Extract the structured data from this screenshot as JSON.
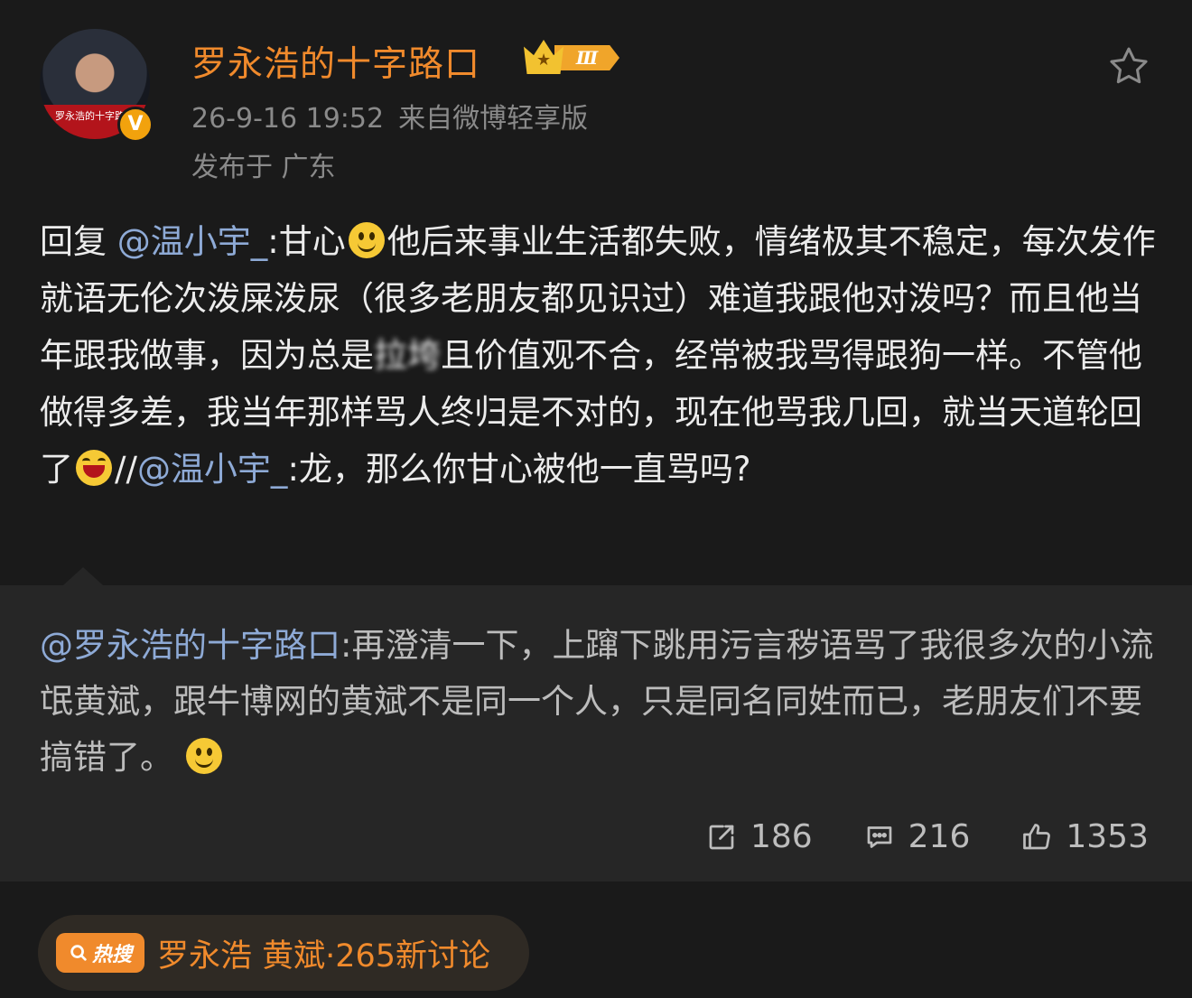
{
  "author": {
    "name": "罗永浩的十字路口",
    "avatar_caption": "罗永浩的十字路口",
    "verified_badge": "V",
    "level_badge": "Ⅲ",
    "timestamp": "26-9-16 19:52",
    "source": "来自微博轻享版",
    "location": "发布于 广东"
  },
  "post": {
    "reply_prefix": "回复",
    "mention_1": "@温小宇_",
    "part_1": ":甘心",
    "part_2": "他后来事业生活都失败，情绪极其不稳定，每次发作就语无伦次泼屎泼尿（很多老朋友都见识过）难道我跟他对泼吗？而且他当年跟我做事，因为总是",
    "blurred": "拉垮",
    "part_3": "且价值观不合，经常被我骂得跟狗一样。不管他做得多差，我当年那样骂人终归是不对的，现在他骂我几回，就当天道轮回了",
    "repost_sep": "//",
    "mention_2": "@温小宇_",
    "part_4": ":龙，那么你甘心被他一直骂吗?"
  },
  "retweet": {
    "mention": "@罗永浩的十字路口",
    "text": ":再澄清一下，上蹿下跳用污言秽语骂了我很多次的小流氓黄斌，跟牛博网的黄斌不是同一个人，只是同名同姓而已，老朋友们不要搞错了。"
  },
  "actions": {
    "repost_count": "186",
    "comment_count": "216",
    "like_count": "1353"
  },
  "hot_search": {
    "badge": "热搜",
    "text": "罗永浩 黄斌·265新讨论"
  },
  "colors": {
    "background": "#1a1a1a",
    "retweet_bg": "#262626",
    "accent_orange": "#f08a2c",
    "mention_blue": "#8eaad6"
  }
}
